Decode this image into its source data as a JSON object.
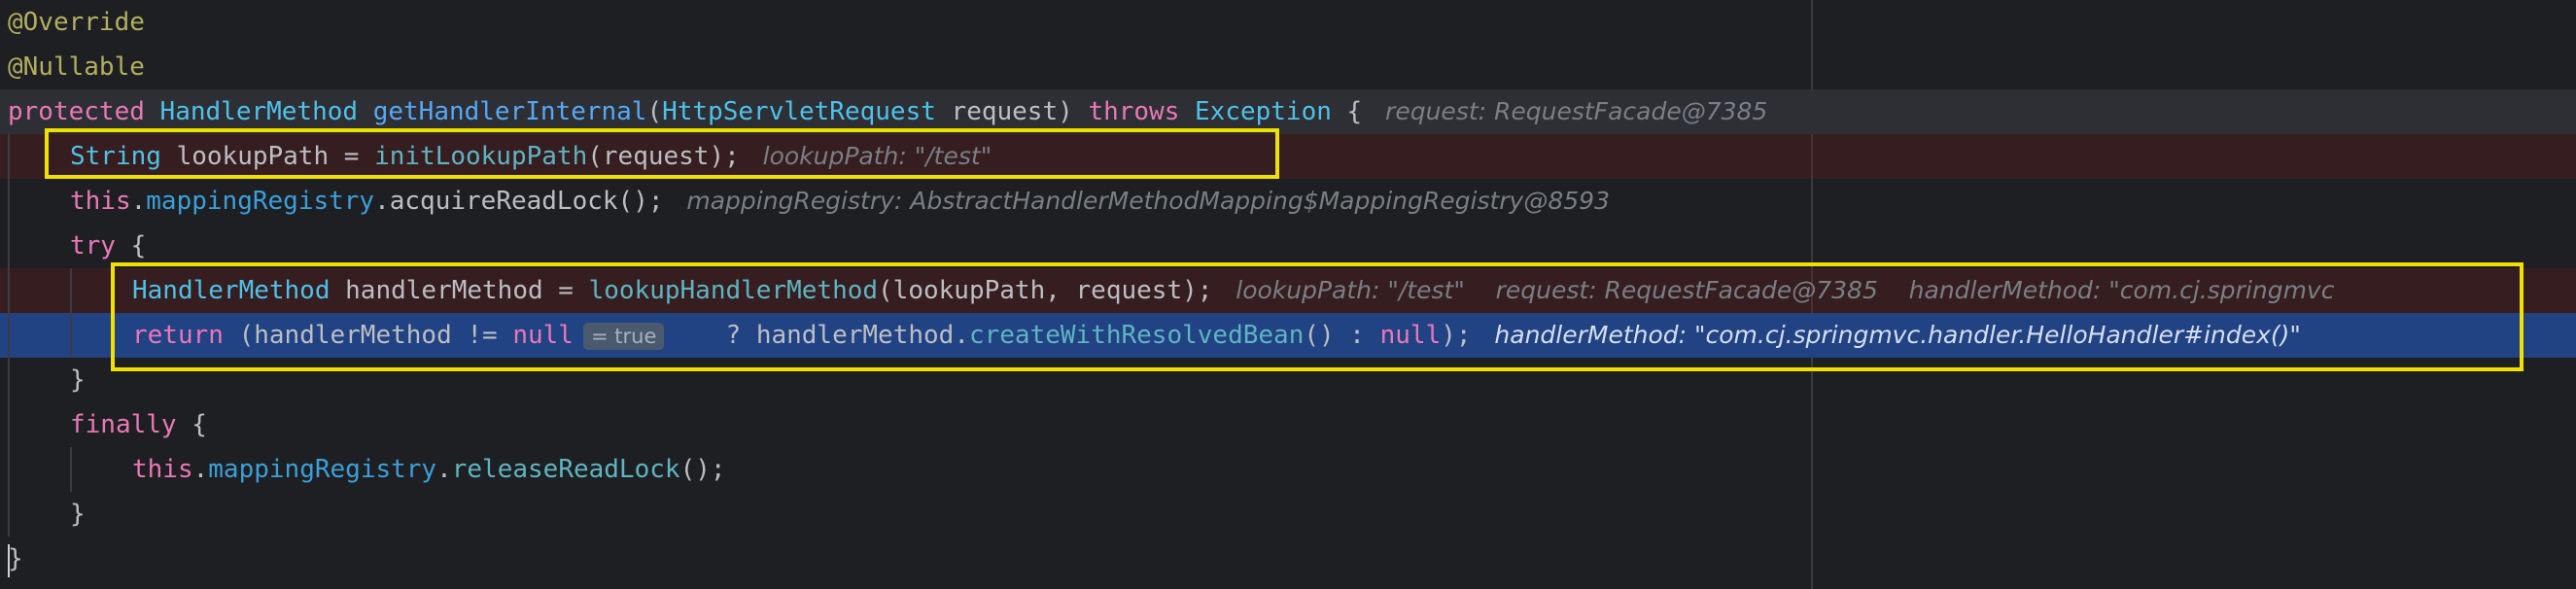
{
  "editor": {
    "lines": [
      {
        "tokens": [
          {
            "text": "@Override",
            "kind": "annotation"
          }
        ]
      },
      {
        "tokens": [
          {
            "text": "@Nullable",
            "kind": "annotation"
          }
        ]
      },
      {
        "tokens": [
          {
            "text": "protected",
            "kind": "keyword-alt"
          },
          {
            "text": " ",
            "kind": "default"
          },
          {
            "text": "HandlerMethod",
            "kind": "type"
          },
          {
            "text": " ",
            "kind": "default"
          },
          {
            "text": "getHandlerInternal",
            "kind": "method"
          },
          {
            "text": "(",
            "kind": "default"
          },
          {
            "text": "HttpServletRequest",
            "kind": "type"
          },
          {
            "text": " request) ",
            "kind": "default"
          },
          {
            "text": "throws",
            "kind": "keyword-alt"
          },
          {
            "text": " ",
            "kind": "default"
          },
          {
            "text": "Exception",
            "kind": "type"
          },
          {
            "text": " {",
            "kind": "default"
          },
          {
            "text": "   request: RequestFacade@7385",
            "kind": "hint"
          }
        ]
      },
      {
        "tokens": [
          {
            "text": "String",
            "kind": "type"
          },
          {
            "text": " lookupPath = ",
            "kind": "default"
          },
          {
            "text": "initLookupPath",
            "kind": "call"
          },
          {
            "text": "(request);",
            "kind": "default"
          },
          {
            "text": "   lookupPath: \"/test\"",
            "kind": "hint"
          }
        ]
      },
      {
        "tokens": [
          {
            "text": "this",
            "kind": "keyword-alt"
          },
          {
            "text": ".",
            "kind": "default"
          },
          {
            "text": "mappingRegistry",
            "kind": "field"
          },
          {
            "text": ".acquireReadLock();",
            "kind": "default"
          },
          {
            "text": "   mappingRegistry: AbstractHandlerMethodMapping$MappingRegistry@8593",
            "kind": "hint"
          }
        ]
      },
      {
        "tokens": [
          {
            "text": "try",
            "kind": "keyword-alt"
          },
          {
            "text": " {",
            "kind": "default"
          }
        ]
      },
      {
        "tokens": [
          {
            "text": "HandlerMethod",
            "kind": "type"
          },
          {
            "text": " handlerMethod = ",
            "kind": "default"
          },
          {
            "text": "lookupHandlerMethod",
            "kind": "call"
          },
          {
            "text": "(lookupPath, request);",
            "kind": "default"
          },
          {
            "text": "   lookupPath: \"/test\"    request: RequestFacade@7385    handlerMethod: \"com.cj.springmvc",
            "kind": "hint"
          }
        ]
      },
      {
        "tokens": [
          {
            "text": "return",
            "kind": "keyword-alt"
          },
          {
            "text": " (handlerMethod != ",
            "kind": "default"
          },
          {
            "text": "null",
            "kind": "keyword-alt"
          },
          {
            "text": "         ",
            "kind": "default"
          },
          {
            "text": " ? handlerMethod.",
            "kind": "default"
          },
          {
            "text": "createWithResolvedBean",
            "kind": "call"
          },
          {
            "text": "() : ",
            "kind": "default"
          },
          {
            "text": "null",
            "kind": "keyword-alt"
          },
          {
            "text": ");",
            "kind": "default"
          },
          {
            "text": "   handlerMethod: \"com.cj.springmvc.handler.HelloHandler#index()\"",
            "kind": "hint"
          }
        ]
      },
      {
        "tokens": [
          {
            "text": "}",
            "kind": "default"
          }
        ]
      },
      {
        "tokens": [
          {
            "text": "finally",
            "kind": "keyword-alt"
          },
          {
            "text": " {",
            "kind": "default"
          }
        ]
      },
      {
        "tokens": [
          {
            "text": "this",
            "kind": "keyword-alt"
          },
          {
            "text": ".",
            "kind": "default"
          },
          {
            "text": "mappingRegistry",
            "kind": "field"
          },
          {
            "text": ".",
            "kind": "default"
          },
          {
            "text": "releaseReadLock",
            "kind": "call"
          },
          {
            "text": "();",
            "kind": "default"
          }
        ]
      },
      {
        "tokens": [
          {
            "text": "}",
            "kind": "default"
          }
        ]
      },
      {
        "tokens": [
          {
            "text": "}",
            "kind": "default"
          }
        ]
      }
    ],
    "inline_value": "= true"
  },
  "colors": {
    "background": "#1e1f22",
    "selection": "#214283",
    "breakpoint_line": "#3c2526",
    "annotation": "#b3ae60",
    "keyword": "#e978b8",
    "type": "#4fc1e9",
    "method": "#56a8f5",
    "highlight_box": "#f0e000"
  }
}
